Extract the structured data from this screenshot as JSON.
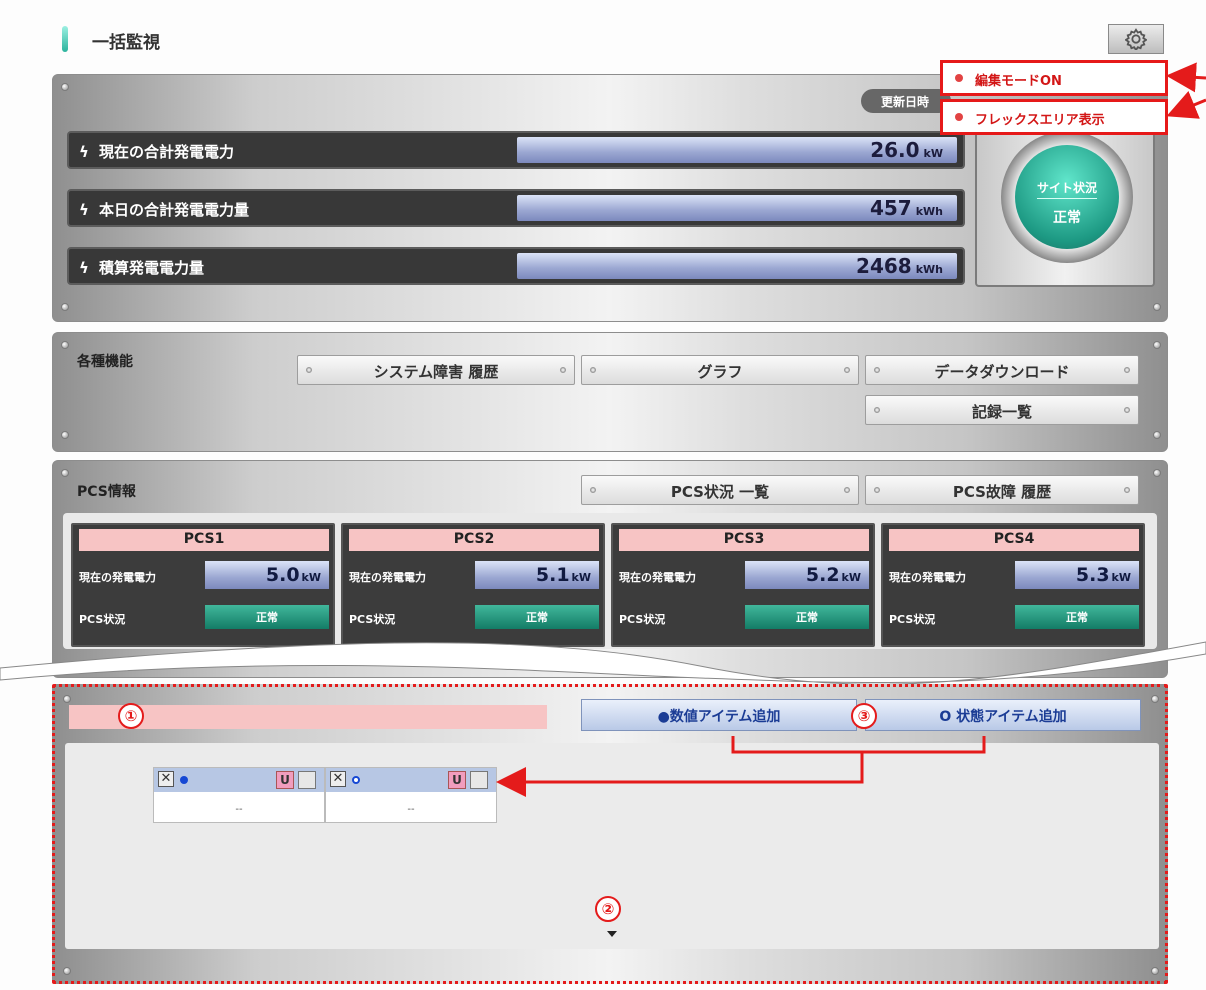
{
  "header": {
    "title": "一括監視",
    "gear_icon": "gear-icon"
  },
  "summary": {
    "update_label": "更新日時",
    "metrics": [
      {
        "label": "現在の合計発電電力",
        "value": "26.0",
        "unit": "kW"
      },
      {
        "label": "本日の合計発電電力量",
        "value": "457",
        "unit": "kWh"
      },
      {
        "label": "積算発電電力量",
        "value": "2468",
        "unit": "kWh"
      }
    ],
    "site_status": {
      "title": "サイト状況",
      "status": "正常"
    }
  },
  "gear_menu": {
    "items": [
      "編集モードON",
      "フレックスエリア表示"
    ]
  },
  "functions": {
    "label": "各種機能",
    "buttons": [
      "システム障害 履歴",
      "グラフ",
      "データダウンロード",
      "記録一覧"
    ]
  },
  "pcs": {
    "label": "PCS情報",
    "buttons": [
      "PCS状況 一覧",
      "PCS故障 履歴"
    ],
    "power_label": "現在の発電電力",
    "status_label": "PCS状況",
    "units": [
      {
        "name": "PCS1",
        "power": "5.0",
        "unit": "kW",
        "status": "正常"
      },
      {
        "name": "PCS2",
        "power": "5.1",
        "unit": "kW",
        "status": "正常"
      },
      {
        "name": "PCS3",
        "power": "5.2",
        "unit": "kW",
        "status": "正常"
      },
      {
        "name": "PCS4",
        "power": "5.3",
        "unit": "kW",
        "status": "正常"
      }
    ]
  },
  "flex": {
    "add_numeric": "●数値アイテム追加",
    "add_state": "O 状態アイテム追加",
    "items": [
      {
        "value": "--"
      },
      {
        "value": "--"
      }
    ]
  },
  "annotations": {
    "badges": [
      "①",
      "②",
      "③"
    ],
    "color": "#e41b1b"
  }
}
